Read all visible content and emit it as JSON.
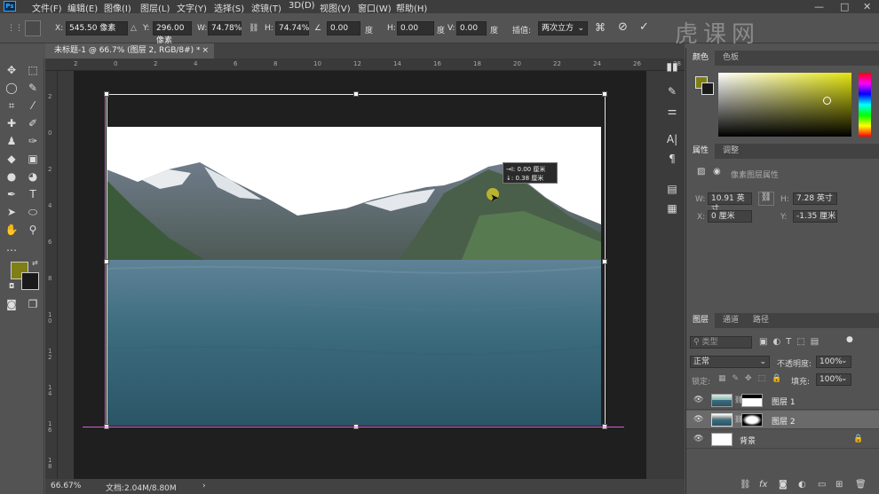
{
  "menubar": {
    "logo": "Ps",
    "items": [
      "文件(F)",
      "编辑(E)",
      "图像(I)",
      "图层(L)",
      "文字(Y)",
      "选择(S)",
      "滤镜(T)",
      "3D(D)",
      "视图(V)",
      "窗口(W)",
      "帮助(H)"
    ]
  },
  "options": {
    "x_label": "X:",
    "x_value": "545.50 像素",
    "y_label": "Y:",
    "y_value": "296.00 像素",
    "w_label": "W:",
    "w_value": "74.78%",
    "h_label": "H:",
    "h_value": "74.74%",
    "angle_value": "0.00",
    "deg1": "度",
    "hskew_label": "H:",
    "hskew_value": "0.00",
    "deg2": "度",
    "vskew_label": "V:",
    "vskew_value": "0.00",
    "deg3": "度",
    "interp_label": "插值:",
    "interp_value": "两次立方"
  },
  "document": {
    "tab_title": "未标题-1 @ 66.7% (图层 2, RGB/8#) *",
    "close": "×"
  },
  "ruler_top": [
    "2",
    "0",
    "2",
    "4",
    "6",
    "8",
    "10",
    "12",
    "14",
    "16",
    "18",
    "20",
    "22",
    "24",
    "26",
    "28"
  ],
  "ruler_left": [
    "2",
    "0",
    "2",
    "4",
    "6",
    "8",
    "1\n0",
    "1\n2",
    "1\n4",
    "1\n6",
    "1\n8"
  ],
  "tooltip": {
    "line1": "→I: 0.00 厘米",
    "line2": "↓: 0.38 厘米"
  },
  "status": {
    "zoom": "66.67%",
    "doc": "文档:2.04M/8.80M"
  },
  "watermark": "虎课网",
  "color_panel": {
    "tabs": [
      "颜色",
      "色板"
    ],
    "fg_color": "#7f7f16",
    "bg_color": "#1a1a1a"
  },
  "props_panel": {
    "tabs": [
      "属性",
      "调整"
    ],
    "subtitle": "像素图层属性",
    "w_label": "W:",
    "w_value": "10.91 英寸",
    "h_label": "H:",
    "h_value": "7.28 英寸",
    "x_label": "X:",
    "x_value": "0 厘米",
    "y_label": "Y:",
    "y_value": "-1.35 厘米"
  },
  "layers_panel": {
    "tabs": [
      "图层",
      "通道",
      "路径"
    ],
    "search_placeholder": "类型",
    "blend_mode": "正常",
    "opacity_label": "不透明度:",
    "opacity_value": "100%",
    "lock_label": "锁定:",
    "fill_label": "填充:",
    "fill_value": "100%",
    "layers": [
      {
        "name": "图层 1"
      },
      {
        "name": "图层 2"
      },
      {
        "name": "背景"
      }
    ],
    "footer_icons": [
      "link-icon",
      "fx-icon",
      "mask-icon",
      "adjustment-icon",
      "group-icon",
      "new-layer-icon",
      "trash-icon"
    ]
  }
}
